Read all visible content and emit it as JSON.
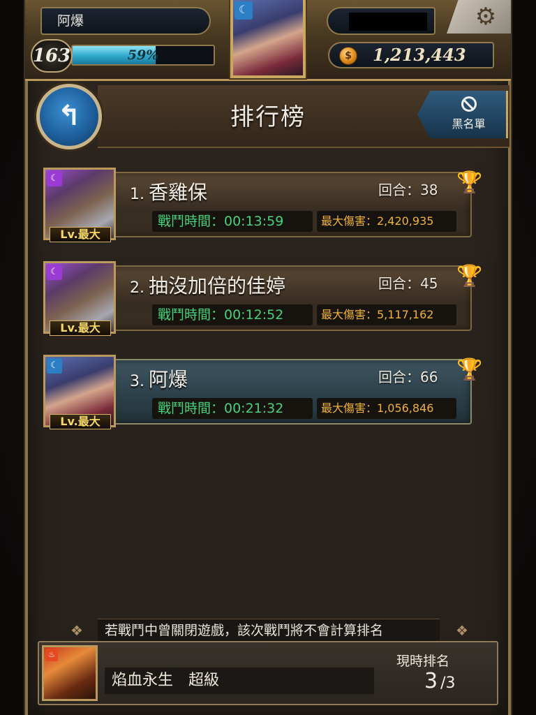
{
  "player": {
    "name": "阿爆",
    "level": "163",
    "exp_percent": 59,
    "exp_label": "59%",
    "coins": "1,213,443"
  },
  "header": {
    "title": "排行榜",
    "blacklist_label": "黑名單"
  },
  "rankings": [
    {
      "rank": "1.",
      "name": "香雞保",
      "rounds_label": "回合：38",
      "time_label": "戰鬥時間：00:13:59",
      "damage_label": "最大傷害：2,420,935",
      "level_tag": "Lv.最大",
      "trophy": "gold"
    },
    {
      "rank": "2.",
      "name": "抽沒加倍的佳婷",
      "rounds_label": "回合：45",
      "time_label": "戰鬥時間：00:12:52",
      "damage_label": "最大傷害：5,117,162",
      "level_tag": "Lv.最大",
      "trophy": "silver"
    },
    {
      "rank": "3.",
      "name": "阿爆",
      "rounds_label": "回合：66",
      "time_label": "戰鬥時間：00:21:32",
      "damage_label": "最大傷害：1,056,846",
      "level_tag": "Lv.最大",
      "trophy": "bronze"
    }
  ],
  "footer": {
    "notice": "若戰鬥中曾關閉遊戲，該次戰鬥將不會計算排名",
    "stage_name": "焰血永生　超級",
    "current_rank_label": "現時排名",
    "current_rank": "3",
    "rank_total": "/3"
  },
  "colors": {
    "accent_gold": "#c9a760",
    "time_green": "#46d37a",
    "damage_orange": "#f0b33a",
    "back_button_blue": "#1e5f9c"
  }
}
